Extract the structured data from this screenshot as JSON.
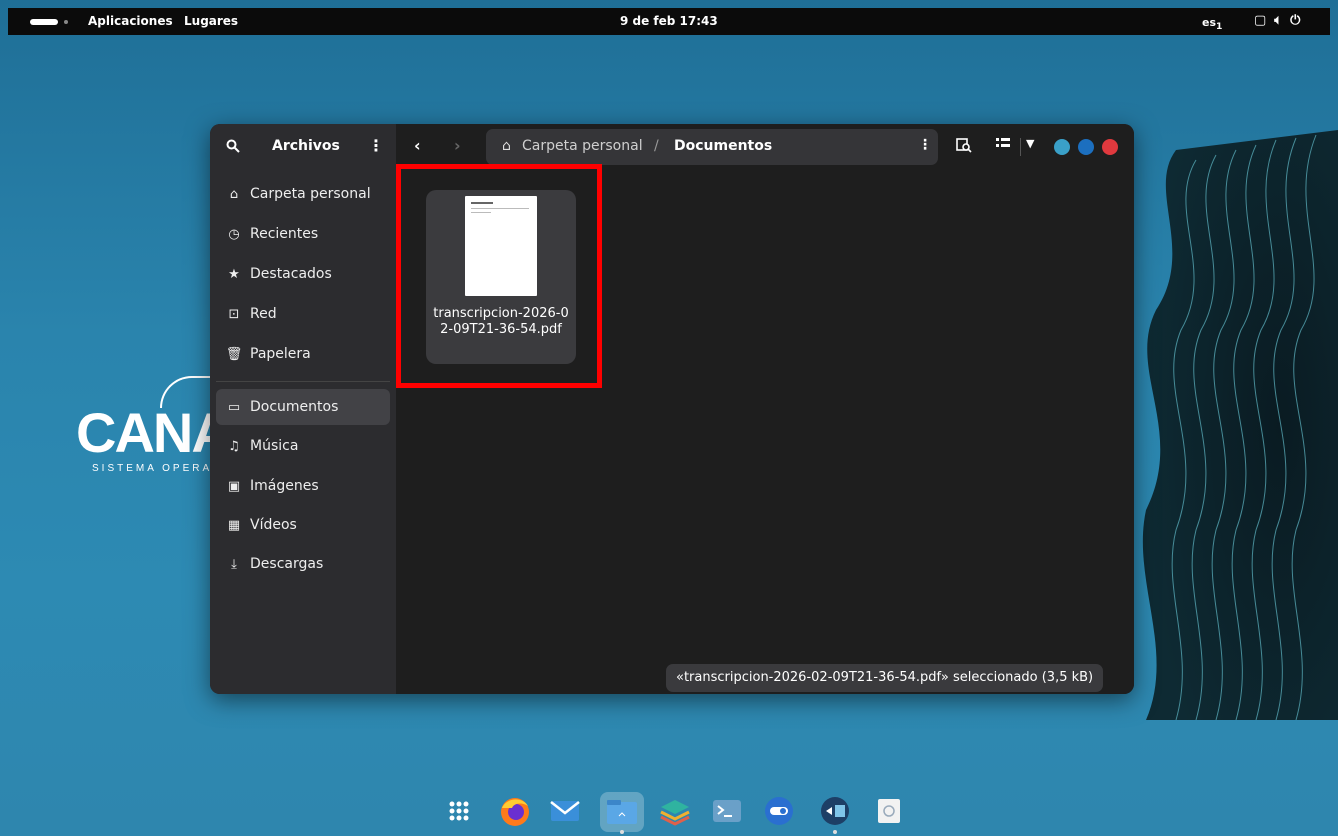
{
  "topbar": {
    "activities_label": "",
    "apps": "Aplicaciones",
    "places": "Lugares",
    "clock": "9 de feb 17:43",
    "lang": "es",
    "tray_icons": [
      "screen-icon",
      "volume-icon",
      "power-icon"
    ]
  },
  "desktop": {
    "logo_text": "CANA",
    "logo_sub": "SISTEMA OPERAT"
  },
  "sidebar": {
    "title": "Archivos",
    "items": [
      {
        "icon": "home-icon",
        "glyph": "⌂",
        "label": "Carpeta personal"
      },
      {
        "icon": "clock-icon",
        "glyph": "◷",
        "label": "Recientes"
      },
      {
        "icon": "star-icon",
        "glyph": "★",
        "label": "Destacados"
      },
      {
        "icon": "network-icon",
        "glyph": "⊡",
        "label": "Red"
      },
      {
        "icon": "trash-icon",
        "glyph": "🗑",
        "label": "Papelera"
      },
      {
        "icon": "document-icon",
        "glyph": "▭",
        "label": "Documentos"
      },
      {
        "icon": "music-icon",
        "glyph": "♫",
        "label": "Música"
      },
      {
        "icon": "image-icon",
        "glyph": "▣",
        "label": "Imágenes"
      },
      {
        "icon": "video-icon",
        "glyph": "▦",
        "label": "Vídeos"
      },
      {
        "icon": "download-icon",
        "glyph": "⤓",
        "label": "Descargas"
      }
    ],
    "active": "Documentos"
  },
  "pathbar": {
    "home": "Carpeta personal",
    "separator": "/",
    "current": "Documentos"
  },
  "files": [
    {
      "name": "transcripcion-2026-02-09T21-36-54.pdf",
      "type": "pdf"
    }
  ],
  "status": "«transcripcion-2026-02-09T21-36-54.pdf» seleccionado  (3,5 kB)",
  "colors": {
    "window_btn_1": "#3aa0c8",
    "window_btn_2": "#1c6fbf",
    "window_btn_close": "#e0393e",
    "highlight": "#ff0000"
  },
  "dock": [
    "apps-grid-icon",
    "firefox-icon",
    "mail-icon",
    "files-icon",
    "layers-icon",
    "terminal-icon",
    "toggle-icon",
    "network-share-icon",
    "trash-icon"
  ]
}
